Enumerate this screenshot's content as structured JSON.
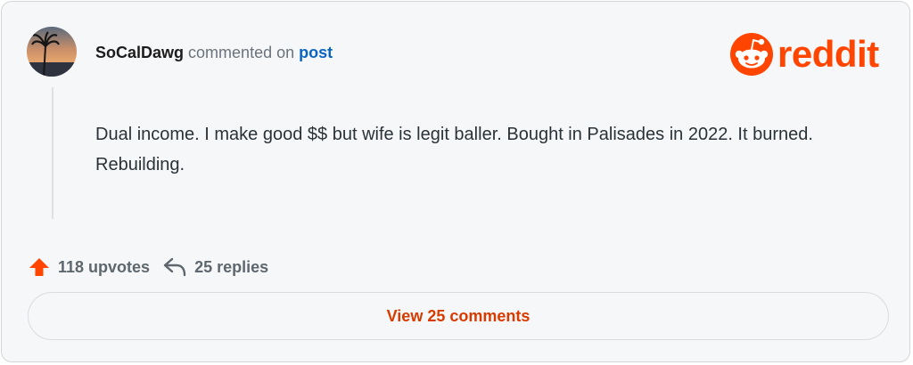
{
  "comment": {
    "username": "SoCalDawg",
    "commented_text": "commented on",
    "post_link": "post",
    "body": "Dual income. I make good $$ but wife is legit baller. Bought in Palisades in 2022. It burned. Rebuilding."
  },
  "brand": {
    "wordmark": "reddit",
    "color": "#ff4500",
    "icon": "reddit-snoo-icon"
  },
  "actions": {
    "upvotes_label": "118 upvotes",
    "replies_label": "25 replies",
    "upvote_icon": "upvote-arrow-icon",
    "reply_icon": "reply-arrow-icon",
    "upvote_color": "#ff4500"
  },
  "footer": {
    "view_comments_label": "View 25 comments",
    "link_color": "#d93a00"
  }
}
